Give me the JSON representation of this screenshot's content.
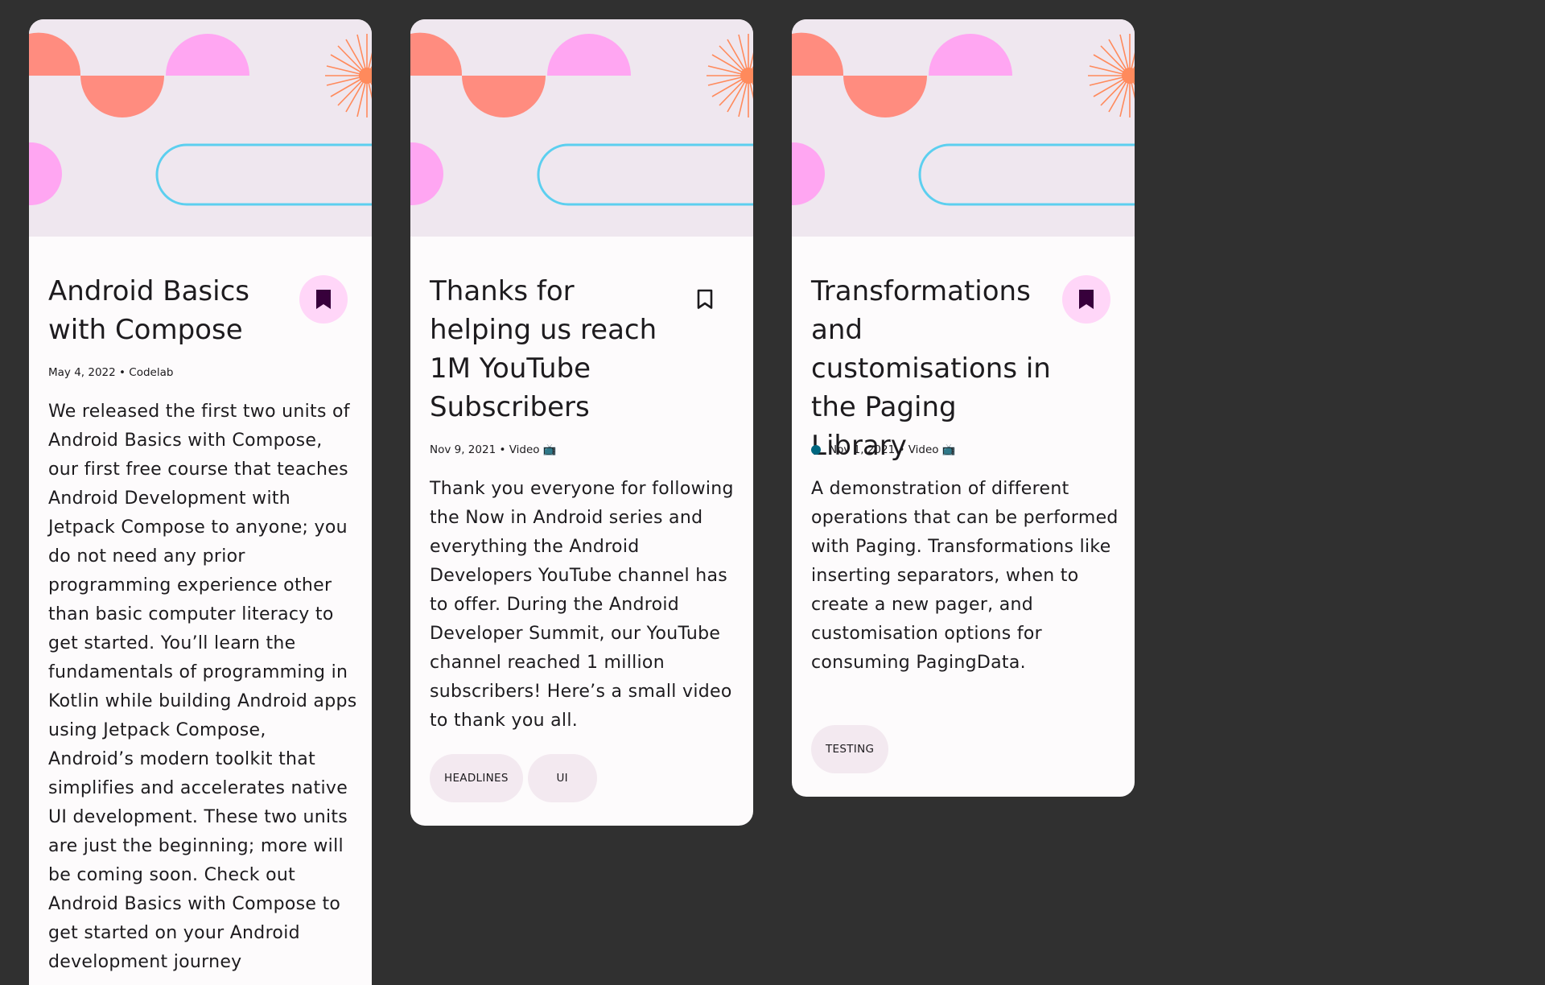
{
  "colors": {
    "background": "#303030",
    "card": "#fdfbfc",
    "header_bg": "#efe7ef",
    "accent_salmon": "#ff8c7f",
    "accent_pink": "#ffa6f2",
    "accent_blue": "#5ccfef",
    "accent_orange": "#ff8a5c",
    "bookmark_bg": "#ffd6f8",
    "bookmark_fill": "#37003b",
    "unread_dot": "#006780",
    "chip_bg": "#f3e9f0"
  },
  "cards": [
    {
      "title": "Android Basics with Compose",
      "bookmarked": true,
      "bookmark_icon": "bookmark-filled-icon",
      "unread": false,
      "meta": "May 4, 2022 • Codelab",
      "body": "We released the first two units of Android Basics with Compose, our first free course that teaches Android Development with Jetpack Compose to anyone; you do not need any prior programming experience other than basic computer literacy to get started. You’ll learn the fundamentals of programming in Kotlin while building Android apps using Jetpack Compose, Android’s modern toolkit that simplifies and accelerates native UI development. These two units are just the beginning; more will be coming soon. Check out Android Basics with Compose to get started on your Android development journey",
      "topics": []
    },
    {
      "title": "Thanks for helping us reach 1M YouTube Subscribers",
      "bookmarked": false,
      "bookmark_icon": "bookmark-outline-icon",
      "unread": false,
      "meta": "Nov 9, 2021 • Video 📺",
      "body": "Thank you everyone for following the Now in Android series and everything the Android Developers YouTube channel has to offer. During the Android Developer Summit, our YouTube channel reached 1 million subscribers! Here’s a small video to thank you all.",
      "topics": [
        "HEADLINES",
        "UI"
      ]
    },
    {
      "title": "Transformations and customisations in the Paging Library",
      "bookmarked": true,
      "bookmark_icon": "bookmark-filled-icon",
      "unread": true,
      "meta": "Nov 1, 2021 • Video 📺",
      "body": "A demonstration of different operations that can be performed with Paging. Transformations like inserting separators, when to create a new pager, and customisation options for consuming PagingData.",
      "topics": [
        "TESTING"
      ]
    }
  ]
}
